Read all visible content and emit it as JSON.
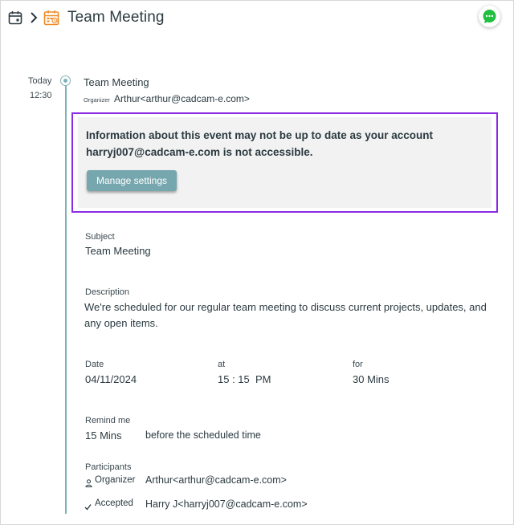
{
  "header": {
    "title": "Team Meeting",
    "icons": [
      "calendar-icon",
      "chevron-right-icon",
      "calendar-event-icon",
      "chat-icon"
    ],
    "accent_color": "#f08a24",
    "chat_color": "#1fbf3f"
  },
  "timeline": {
    "day": "Today",
    "time": "12:30",
    "line_color": "#7fb1b8"
  },
  "event": {
    "title": "Team Meeting",
    "organizer_label": "Organizer",
    "organizer_value": "Arthur<arthur@cadcam-e.com>"
  },
  "alert": {
    "message": "Information about this event may not be up to  date as your account harryj007@cadcam-e.com is not accessible.",
    "button_label": "Manage settings",
    "border_color": "#8a2be2"
  },
  "details": {
    "subject_label": "Subject",
    "subject_value": "Team Meeting",
    "description_label": "Description",
    "description_value": "We're scheduled for our regular team meeting to discuss current projects, updates, and any open items.",
    "date_label": "Date",
    "date_value": "04/11/2024",
    "at_label": "at",
    "at_value": "15 : 15  PM",
    "for_label": "for",
    "for_value": "30 Mins",
    "remind_label": "Remind me",
    "remind_value": "15 Mins",
    "remind_suffix": "before the scheduled time",
    "participants_label": "Participants",
    "participants": [
      {
        "role": "Organizer",
        "icon": "person-icon",
        "value": "Arthur<arthur@cadcam-e.com>"
      },
      {
        "role": "Accepted",
        "icon": "check-icon",
        "value": "Harry J<harryj007@cadcam-e.com>"
      }
    ]
  }
}
